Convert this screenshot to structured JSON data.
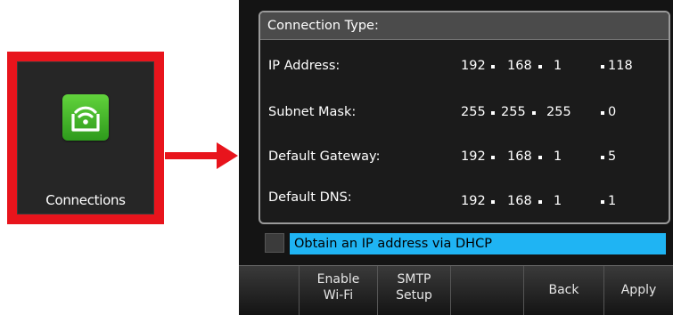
{
  "app_tile": {
    "label": "Connections",
    "icon": "wifi-connections-icon",
    "highlight_color": "#e8141c"
  },
  "panel": {
    "title": "Connection Type:",
    "fields": [
      {
        "label": "IP Address:",
        "octets": [
          "192",
          "168",
          "1",
          "118"
        ]
      },
      {
        "label": "Subnet Mask:",
        "octets": [
          "255",
          "255",
          "255",
          "0"
        ]
      },
      {
        "label": "Default Gateway:",
        "octets": [
          "192",
          "168",
          "1",
          "5"
        ]
      },
      {
        "label": "Default DNS:",
        "octets": [
          "192",
          "168",
          "1",
          "1"
        ]
      }
    ],
    "dhcp_option": "Obtain an IP address via DHCP",
    "selection_color": "#1fb4f3"
  },
  "softkeys": {
    "enable_wifi": [
      "Enable",
      "Wi-Fi"
    ],
    "smtp_setup": [
      "SMTP",
      "Setup"
    ],
    "back": "Back",
    "apply": "Apply"
  }
}
